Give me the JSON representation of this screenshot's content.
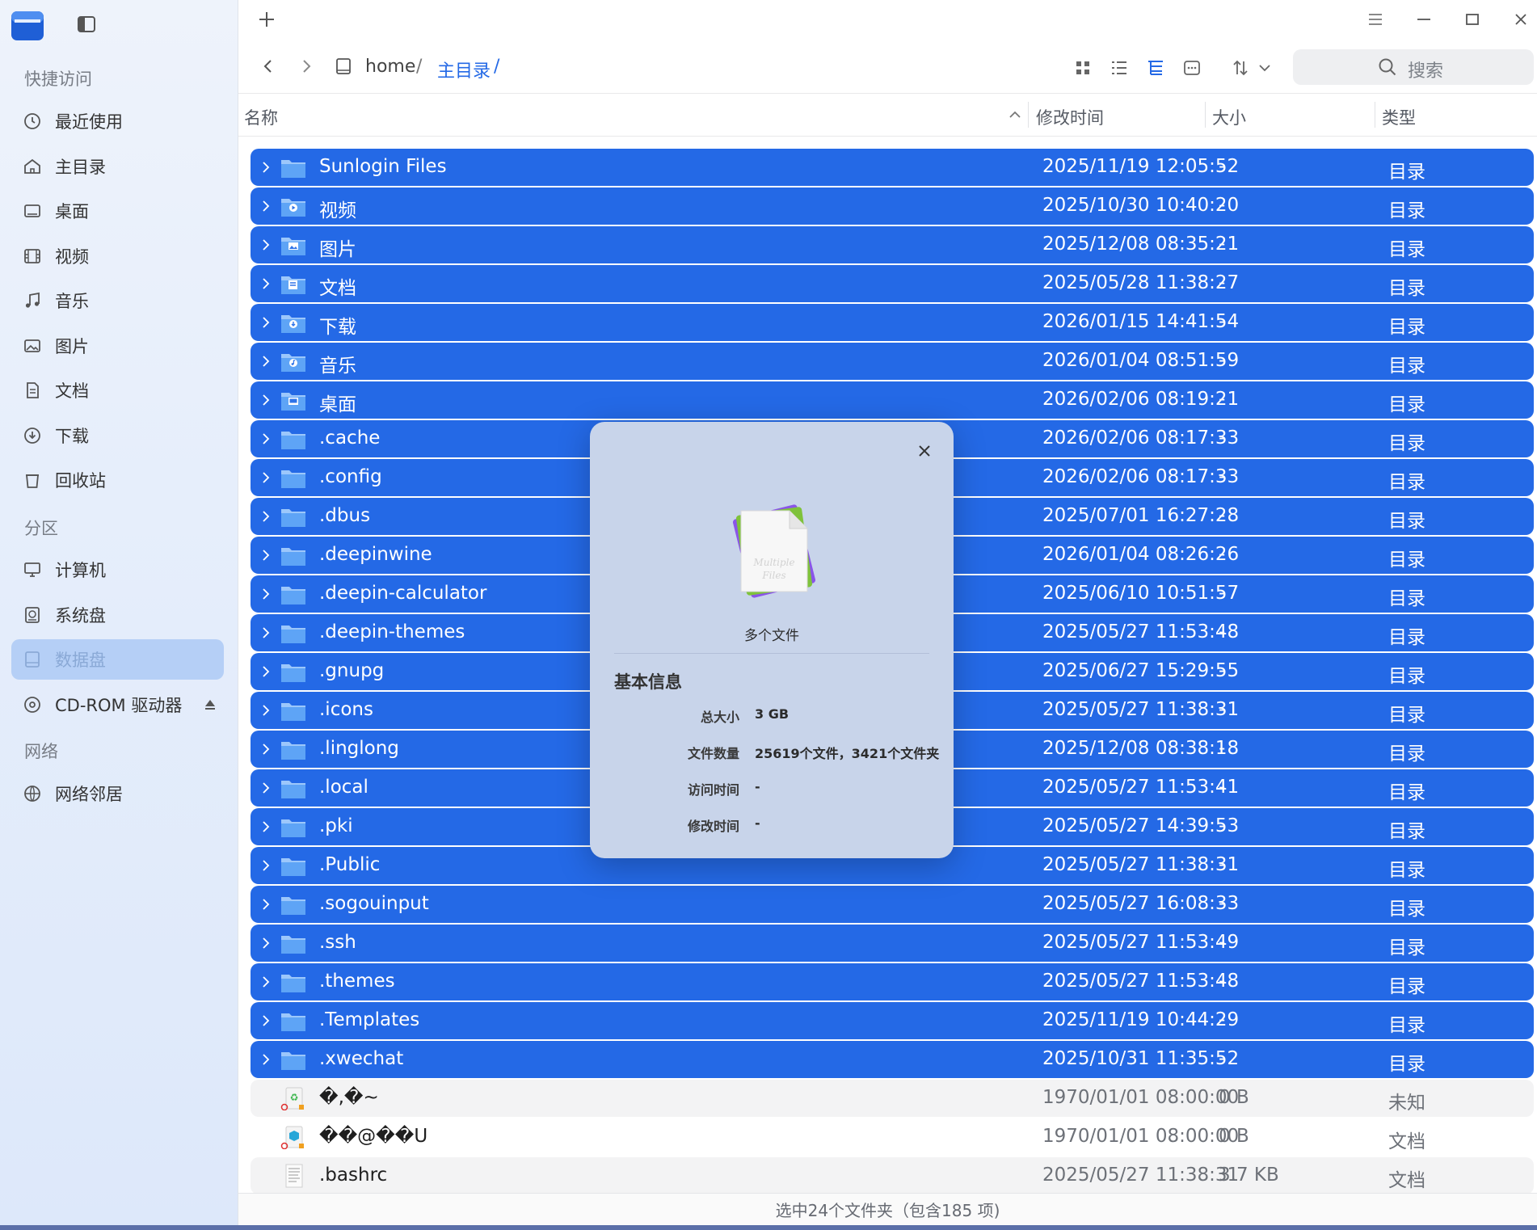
{
  "titlebar": {
    "new_tab_icon": "plus-icon",
    "menu_icon": "menu-icon",
    "minimize_icon": "minimize-icon",
    "maximize_icon": "maximize-icon",
    "close_icon": "close-icon"
  },
  "sidebar": {
    "quick_access_title": "快捷访问",
    "quick_access": [
      {
        "label": "最近使用",
        "icon": "clock-icon"
      },
      {
        "label": "主目录",
        "icon": "home-icon"
      },
      {
        "label": "桌面",
        "icon": "desktop-icon"
      },
      {
        "label": "视频",
        "icon": "video-icon"
      },
      {
        "label": "音乐",
        "icon": "music-icon"
      },
      {
        "label": "图片",
        "icon": "picture-icon"
      },
      {
        "label": "文档",
        "icon": "document-icon"
      },
      {
        "label": "下载",
        "icon": "download-icon"
      },
      {
        "label": "回收站",
        "icon": "trash-icon"
      }
    ],
    "partitions_title": "分区",
    "partitions": [
      {
        "label": "计算机",
        "icon": "computer-icon"
      },
      {
        "label": "系统盘",
        "icon": "disk-icon"
      },
      {
        "label": "数据盘",
        "icon": "drive-icon",
        "active": true
      },
      {
        "label": "CD-ROM 驱动器",
        "icon": "cdrom-icon"
      }
    ],
    "network_title": "网络",
    "network": [
      {
        "label": "网络邻居",
        "icon": "network-icon"
      }
    ]
  },
  "toolbar": {
    "breadcrumb": {
      "root": "home",
      "sep1": "/",
      "current": "主目录",
      "sep2": "/"
    },
    "search_placeholder": "搜索",
    "accent": "#2469e6"
  },
  "columns": {
    "name": "名称",
    "modified": "修改时间",
    "size": "大小",
    "type": "类型"
  },
  "files": [
    {
      "name": "Sunlogin Files",
      "modified": "2025/11/19 12:05:52",
      "size": "-",
      "type": "目录",
      "selected": true,
      "expand": true,
      "icon": "folder"
    },
    {
      "name": "视频",
      "modified": "2025/10/30 10:40:20",
      "size": "-",
      "type": "目录",
      "selected": true,
      "expand": true,
      "icon": "folder-video"
    },
    {
      "name": "图片",
      "modified": "2025/12/08 08:35:21",
      "size": "-",
      "type": "目录",
      "selected": true,
      "expand": true,
      "icon": "folder-picture"
    },
    {
      "name": "文档",
      "modified": "2025/05/28 11:38:27",
      "size": "-",
      "type": "目录",
      "selected": true,
      "expand": true,
      "icon": "folder-document"
    },
    {
      "name": "下载",
      "modified": "2026/01/15 14:41:54",
      "size": "-",
      "type": "目录",
      "selected": true,
      "expand": true,
      "icon": "folder-download"
    },
    {
      "name": "音乐",
      "modified": "2026/01/04 08:51:59",
      "size": "-",
      "type": "目录",
      "selected": true,
      "expand": true,
      "icon": "folder-music"
    },
    {
      "name": "桌面",
      "modified": "2026/02/06 08:19:21",
      "size": "-",
      "type": "目录",
      "selected": true,
      "expand": true,
      "icon": "folder-desktop"
    },
    {
      "name": ".cache",
      "modified": "2026/02/06 08:17:33",
      "size": "-",
      "type": "目录",
      "selected": true,
      "expand": true,
      "icon": "folder"
    },
    {
      "name": ".config",
      "modified": "2026/02/06 08:17:33",
      "size": "-",
      "type": "目录",
      "selected": true,
      "expand": true,
      "icon": "folder"
    },
    {
      "name": ".dbus",
      "modified": "2025/07/01 16:27:28",
      "size": "-",
      "type": "目录",
      "selected": true,
      "expand": true,
      "icon": "folder"
    },
    {
      "name": ".deepinwine",
      "modified": "2026/01/04 08:26:26",
      "size": "-",
      "type": "目录",
      "selected": true,
      "expand": true,
      "icon": "folder"
    },
    {
      "name": ".deepin-calculator",
      "modified": "2025/06/10 10:51:57",
      "size": "-",
      "type": "目录",
      "selected": true,
      "expand": true,
      "icon": "folder"
    },
    {
      "name": ".deepin-themes",
      "modified": "2025/05/27 11:53:48",
      "size": "-",
      "type": "目录",
      "selected": true,
      "expand": true,
      "icon": "folder"
    },
    {
      "name": ".gnupg",
      "modified": "2025/06/27 15:29:55",
      "size": "-",
      "type": "目录",
      "selected": true,
      "expand": true,
      "icon": "folder"
    },
    {
      "name": ".icons",
      "modified": "2025/05/27 11:38:31",
      "size": "-",
      "type": "目录",
      "selected": true,
      "expand": true,
      "icon": "folder"
    },
    {
      "name": ".linglong",
      "modified": "2025/12/08 08:38:18",
      "size": "-",
      "type": "目录",
      "selected": true,
      "expand": true,
      "icon": "folder"
    },
    {
      "name": ".local",
      "modified": "2025/05/27 11:53:41",
      "size": "-",
      "type": "目录",
      "selected": true,
      "expand": true,
      "icon": "folder"
    },
    {
      "name": ".pki",
      "modified": "2025/05/27 14:39:53",
      "size": "-",
      "type": "目录",
      "selected": true,
      "expand": true,
      "icon": "folder"
    },
    {
      "name": ".Public",
      "modified": "2025/05/27 11:38:31",
      "size": "-",
      "type": "目录",
      "selected": true,
      "expand": true,
      "icon": "folder"
    },
    {
      "name": ".sogouinput",
      "modified": "2025/05/27 16:08:33",
      "size": "-",
      "type": "目录",
      "selected": true,
      "expand": true,
      "icon": "folder"
    },
    {
      "name": ".ssh",
      "modified": "2025/05/27 11:53:49",
      "size": "-",
      "type": "目录",
      "selected": true,
      "expand": true,
      "icon": "folder"
    },
    {
      "name": ".themes",
      "modified": "2025/05/27 11:53:48",
      "size": "-",
      "type": "目录",
      "selected": true,
      "expand": true,
      "icon": "folder"
    },
    {
      "name": ".Templates",
      "modified": "2025/11/19 10:44:29",
      "size": "-",
      "type": "目录",
      "selected": true,
      "expand": true,
      "icon": "folder"
    },
    {
      "name": ".xwechat",
      "modified": "2025/10/31 11:35:52",
      "size": "-",
      "type": "目录",
      "selected": true,
      "expand": true,
      "icon": "folder"
    },
    {
      "name": "�,�~",
      "modified": "1970/01/01 08:00:00",
      "size": "0 B",
      "type": "未知",
      "selected": false,
      "expand": false,
      "icon": "unknown-file"
    },
    {
      "name": "��@��U",
      "modified": "1970/01/01 08:00:00",
      "size": "0 B",
      "type": "文档",
      "selected": false,
      "expand": false,
      "icon": "package-file"
    },
    {
      "name": ".bashrc",
      "modified": "2025/05/27 11:38:31",
      "size": "3.7 KB",
      "type": "文档",
      "selected": false,
      "expand": false,
      "icon": "text-file"
    }
  ],
  "statusbar": {
    "text": "选中24个文件夹（包含185 项)"
  },
  "dialog": {
    "caption": "多个文件",
    "section_title": "基本信息",
    "fields": [
      {
        "label": "总大小",
        "value": "3 GB"
      },
      {
        "label": "文件数量",
        "value": "25619个文件，3421个文件夹"
      },
      {
        "label": "访问时间",
        "value": "-"
      },
      {
        "label": "修改时间",
        "value": "-"
      }
    ]
  }
}
